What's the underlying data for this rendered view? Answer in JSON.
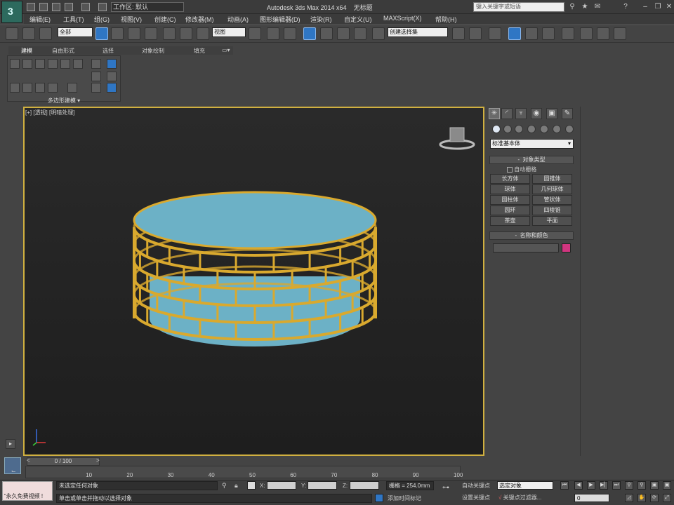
{
  "title_bar": {
    "workspace": "工作区: 默认",
    "app_title": "Autodesk 3ds Max 2014 x64",
    "file": "无标题",
    "search_placeholder": "键入关键字或短语"
  },
  "menu": [
    "编辑(E)",
    "工具(T)",
    "组(G)",
    "视图(V)",
    "创建(C)",
    "修改器(M)",
    "动画(A)",
    "图形编辑器(D)",
    "渲染(R)",
    "自定义(U)",
    "MAXScript(X)",
    "帮助(H)"
  ],
  "toolbar": {
    "selection_filter": "全部",
    "ref_coord": "视图",
    "named_selection": "创建选择集"
  },
  "ribbon": {
    "tabs": [
      "建模",
      "自由形式",
      "选择",
      "对象绘制",
      "填充"
    ],
    "panel_label": "多边形建模"
  },
  "viewport": {
    "label": "[+] [透视] [明暗处理]"
  },
  "command_panel": {
    "category": "标准基本体",
    "object_type_title": "对象类型",
    "autogrid": "自动栅格",
    "buttons": [
      "长方体",
      "圆锥体",
      "球体",
      "几何球体",
      "圆柱体",
      "管状体",
      "圆环",
      "四棱锥",
      "茶壶",
      "平面"
    ],
    "name_color_title": "名称和颜色",
    "object_color": "#d0357f"
  },
  "timeline": {
    "frame": "0 / 100",
    "ticks": [
      "0",
      "10",
      "20",
      "30",
      "40",
      "50",
      "60",
      "70",
      "80",
      "90",
      "100"
    ]
  },
  "status": {
    "maxscript": "“永久免费视频 !",
    "line1": "未选定任何对象",
    "line2": "单击或单击并拖动以选择对象",
    "x_label": "X:",
    "y_label": "Y:",
    "z_label": "Z:",
    "grid": "栅格 = 254.0mm",
    "add_tag": "添加时间标记",
    "autokey": "自动关键点",
    "set_key": "设置关键点",
    "key_filter": "选定对象",
    "key_filter_btn": "关键点过滤器...",
    "frame_field": "0"
  },
  "colors": {
    "cylinder": "#6cb1c6",
    "cage": "#d9a92e",
    "viewport_border": "#d0b040"
  }
}
